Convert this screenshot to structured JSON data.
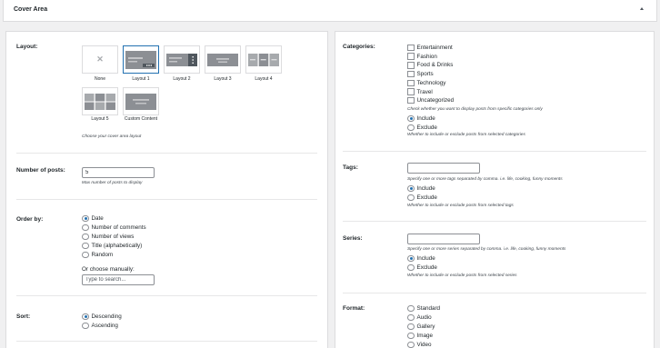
{
  "header": {
    "title": "Cover Area"
  },
  "left": {
    "layout": {
      "label": "Layout:",
      "options": [
        "None",
        "Layout 1",
        "Layout 2",
        "Layout 3",
        "Layout 4",
        "Layout 5",
        "Custom Content"
      ],
      "selected": "Layout 1",
      "hint": "Choose your cover area layout"
    },
    "num_posts": {
      "label": "Number of posts:",
      "value": "5",
      "hint": "Max number of posts to display"
    },
    "order_by": {
      "label": "Order by:",
      "options": [
        "Date",
        "Number of comments",
        "Number of views",
        "Title (alphabetically)",
        "Random"
      ],
      "selected": "Date",
      "manual_label": "Or choose manually:",
      "manual_placeholder": "Type to search..."
    },
    "sort": {
      "label": "Sort:",
      "options": [
        "Descending",
        "Ascending"
      ],
      "selected": "Descending"
    }
  },
  "right": {
    "categories": {
      "label": "Categories:",
      "items": [
        "Entertainment",
        "Fashion",
        "Food & Drinks",
        "Sports",
        "Technology",
        "Travel",
        "Uncategorized"
      ],
      "hint1": "Check whether you want to display posts from specific categories only",
      "mode_options": [
        "Include",
        "Exclude"
      ],
      "mode_selected": "Include",
      "hint2": "Whether to include or exclude posts from selected categories"
    },
    "tags": {
      "label": "Tags:",
      "value": "",
      "hint1": "Specify one or more tags separated by comma. i.e. life, cooking, funny moments",
      "mode_options": [
        "Include",
        "Exclude"
      ],
      "mode_selected": "Include",
      "hint2": "Whether to include or exclude posts from selected tags"
    },
    "series": {
      "label": "Series:",
      "value": "",
      "hint1": "Specify one or more series separated by comma. i.e. life, cooking, funny moments",
      "mode_options": [
        "Include",
        "Exclude"
      ],
      "mode_selected": "Include",
      "hint2": "Whether to include or exclude posts from selected series"
    },
    "format": {
      "label": "Format:",
      "options": [
        "Standard",
        "Audio",
        "Gallery",
        "Image",
        "Video"
      ]
    }
  }
}
